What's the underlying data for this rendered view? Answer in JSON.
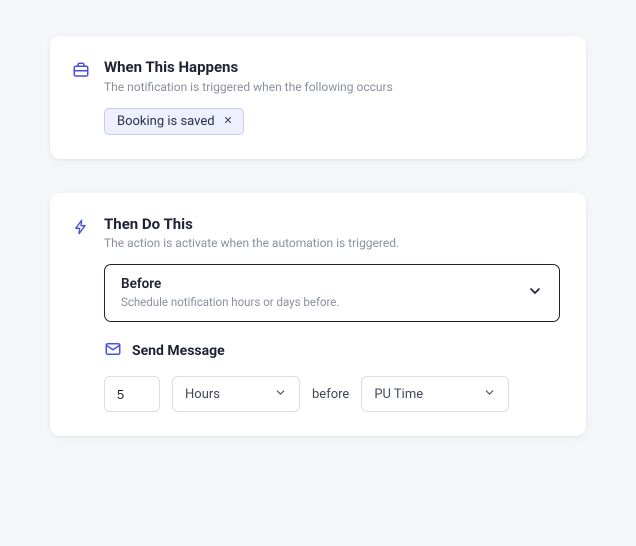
{
  "trigger": {
    "title": "When This Happens",
    "subtitle": "The notification is triggered when the following occurs",
    "chip": {
      "label": "Booking is saved"
    }
  },
  "action": {
    "title": "Then Do This",
    "subtitle": "The action is activate when the automation is triggered.",
    "timing_select": {
      "label": "Before",
      "desc": "Schedule notification hours or days before."
    },
    "send_message": {
      "header": "Send Message",
      "amount": "5",
      "units": "Hours",
      "joiner": "before",
      "reference": "PU Time"
    }
  },
  "icons": {
    "briefcase": "briefcase-icon",
    "bolt": "bolt-icon",
    "mail": "mail-icon",
    "chevron_down": "chevron-down-icon",
    "close": "close-icon"
  },
  "colors": {
    "accent": "#4a4fe4",
    "chip_bg": "#eef0fd",
    "chip_border": "#c7cced",
    "text": "#1e2233",
    "muted": "#8a8f9e",
    "border": "#dcdfe8"
  }
}
